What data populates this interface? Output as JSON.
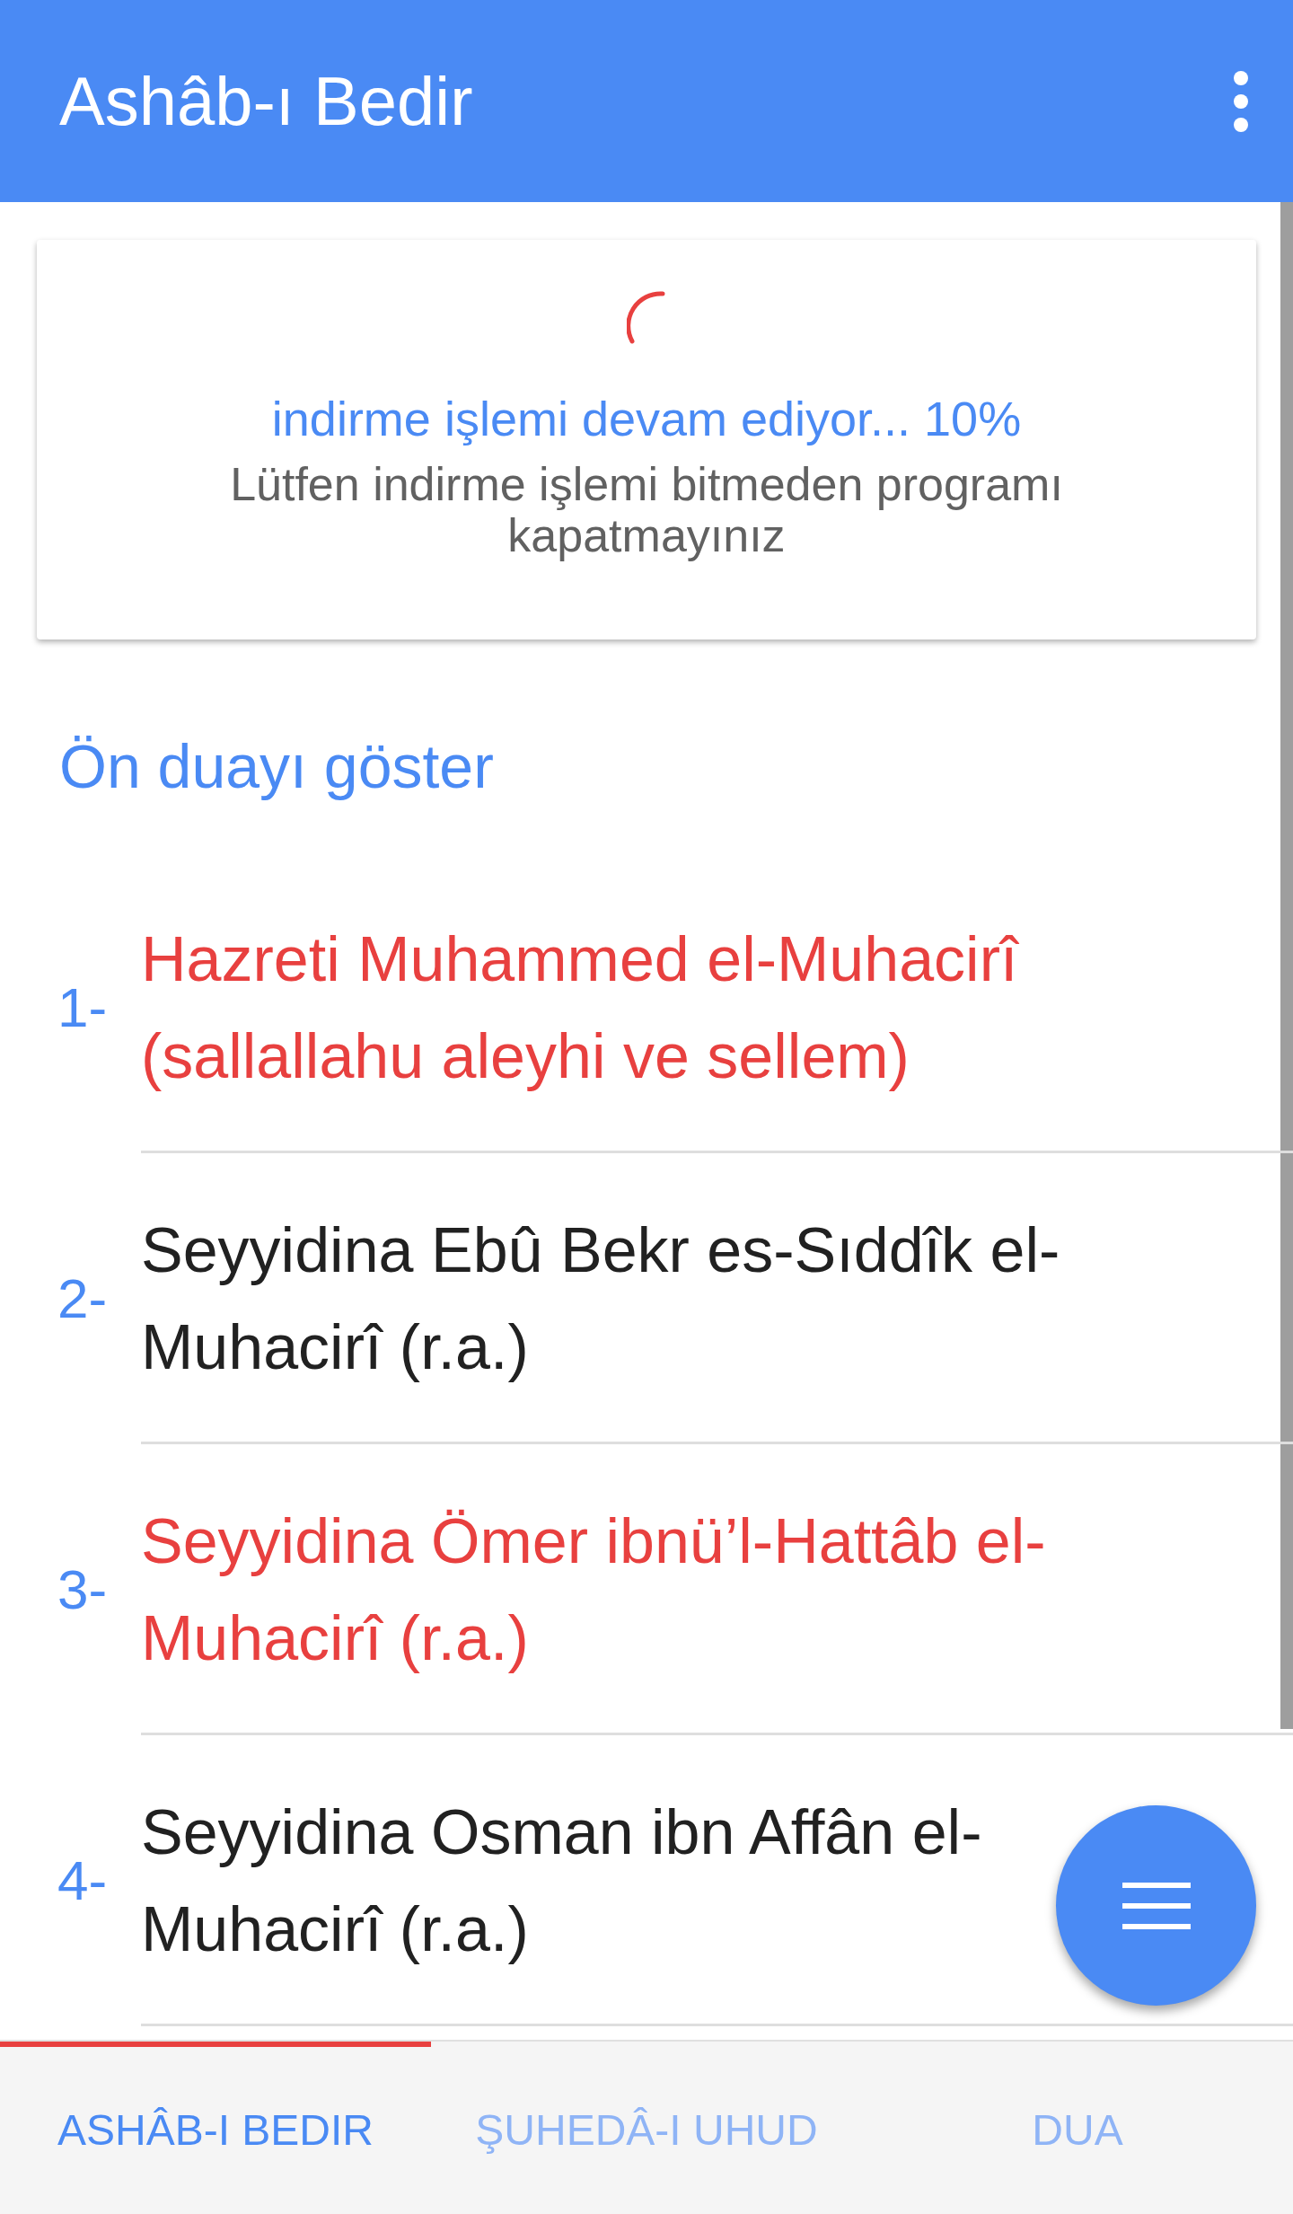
{
  "app_bar": {
    "title": "Ashâb-ı Bedir"
  },
  "download_card": {
    "progress_text": "indirme işlemi devam ediyor... 10%",
    "warning": "Lütfen indirme işlemi bitmeden programı kapatmayınız"
  },
  "show_prayer_link": "Ön duayı göster",
  "list": [
    {
      "number": "1-",
      "name": "Hazreti Muhammed el-Muhacirî (sallallahu aleyhi ve sellem)",
      "color": "#e8403f"
    },
    {
      "number": "2-",
      "name": "Seyyidina Ebû Bekr es-Sıddîk el-Muhacirî (r.a.)",
      "color": "#212121"
    },
    {
      "number": "3-",
      "name": "Seyyidina Ömer ibnü’l-Hattâb el-Muhacirî (r.a.)",
      "color": "#e8403f"
    },
    {
      "number": "4-",
      "name": "Seyyidina Osman ibn Affân el-Muhacirî (r.a.)",
      "color": "#212121"
    }
  ],
  "tabs": [
    {
      "label": "ASHÂB-I BEDIR",
      "selected": true
    },
    {
      "label": "ŞUHEDÂ-I UHUD",
      "selected": false
    },
    {
      "label": "DUA",
      "selected": false
    }
  ]
}
